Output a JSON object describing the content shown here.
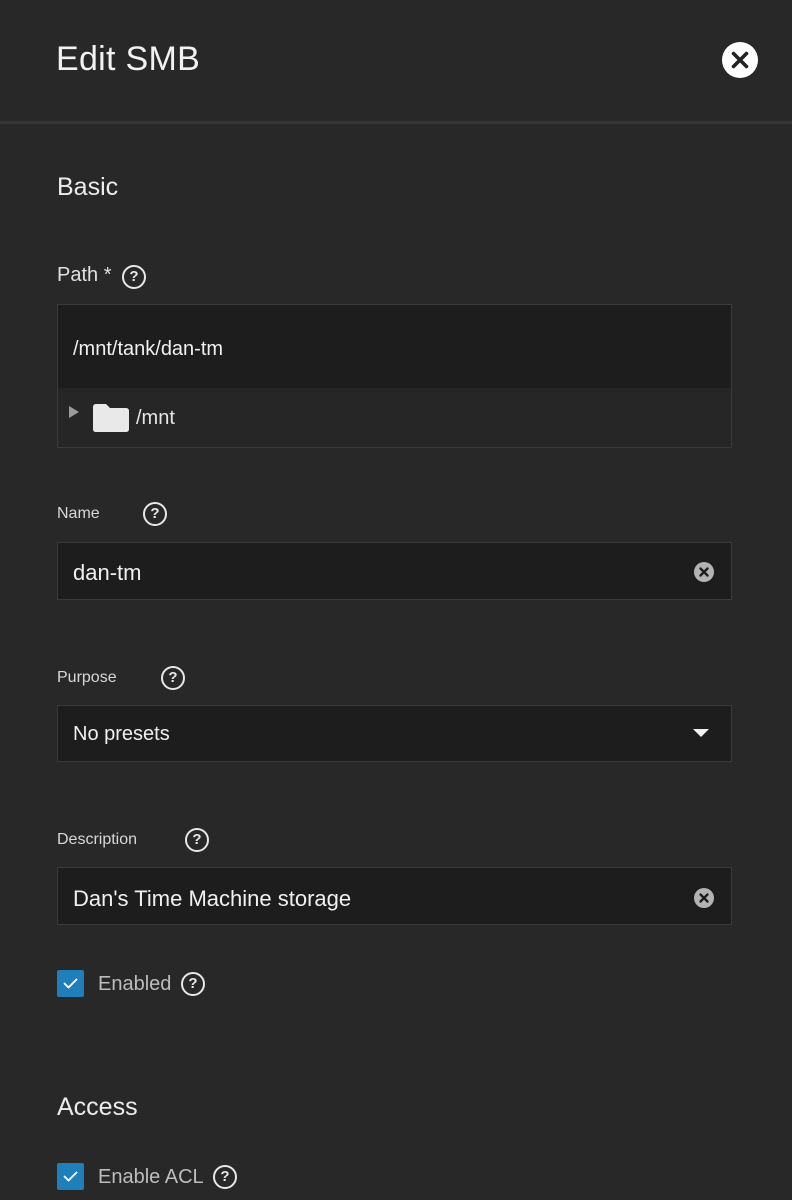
{
  "dialog": {
    "title": "Edit SMB"
  },
  "sections": {
    "basic": "Basic",
    "access": "Access"
  },
  "path": {
    "label": "Path *",
    "value": "/mnt/tank/dan-tm",
    "tree_root": "/mnt"
  },
  "name": {
    "label": "Name",
    "value": "dan-tm"
  },
  "purpose": {
    "label": "Purpose",
    "selected": "No presets"
  },
  "description": {
    "label": "Description",
    "value": "Dan's Time Machine storage"
  },
  "enabled": {
    "label": "Enabled",
    "checked": true
  },
  "enable_acl": {
    "label": "Enable ACL",
    "checked": true
  },
  "help_glyph": "?",
  "colors": {
    "background": "#282828",
    "input_background": "#1d1d1d",
    "checkbox": "#1e7fbb"
  }
}
